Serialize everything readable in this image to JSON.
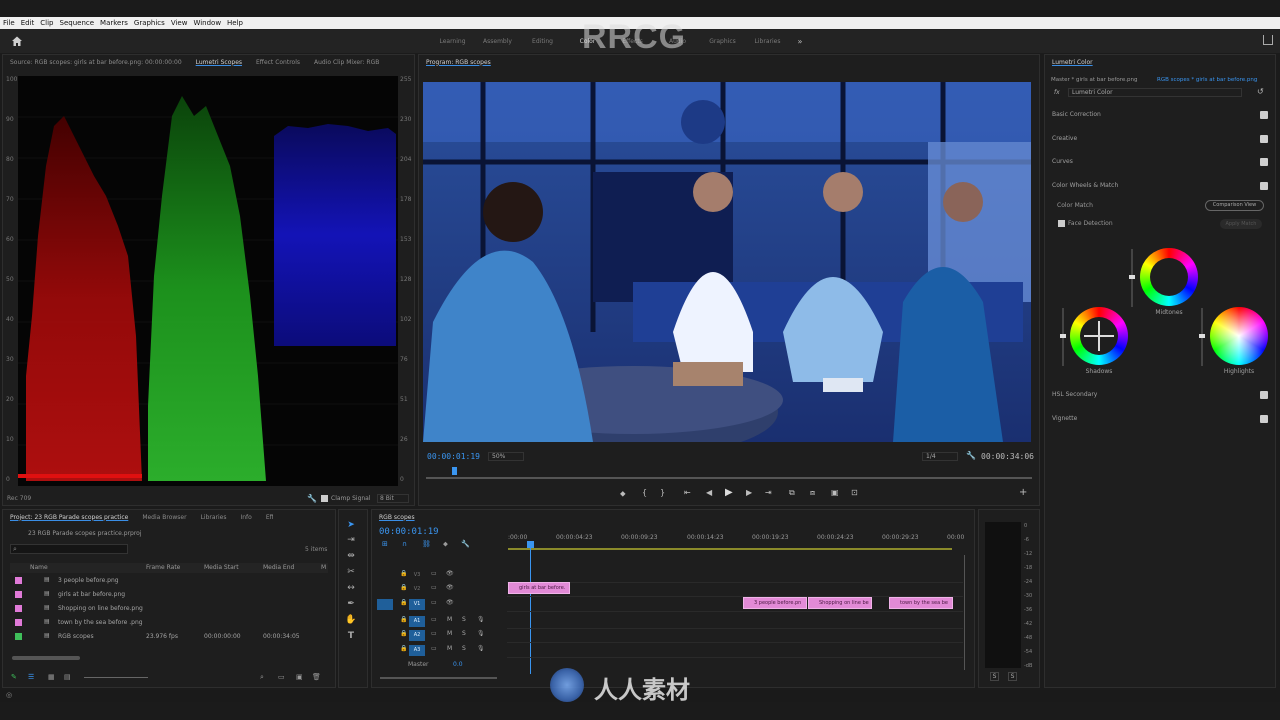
{
  "menu": [
    "File",
    "Edit",
    "Clip",
    "Sequence",
    "Markers",
    "Graphics",
    "View",
    "Window",
    "Help"
  ],
  "workspaces": [
    "Learning",
    "Assembly",
    "Editing",
    "Color",
    "Effects",
    "Audio",
    "Graphics",
    "Libraries"
  ],
  "active_workspace": "Color",
  "watermark": "RRCG",
  "source_panel": {
    "tabs": [
      "Source: RGB scopes: girls at bar before.png: 00:00:00:00",
      "Lumetri Scopes",
      "Effect Controls",
      "Audio Clip Mixer: RGB"
    ],
    "active_tab": "Lumetri Scopes",
    "left_scale": [
      "100",
      "90",
      "80",
      "70",
      "60",
      "50",
      "40",
      "30",
      "20",
      "10",
      "0"
    ],
    "right_scale": [
      "255",
      "230",
      "204",
      "178",
      "153",
      "128",
      "102",
      "76",
      "51",
      "26",
      "0"
    ],
    "footer_left": "Rec 709",
    "clamp_signal": "Clamp Signal",
    "bit_depth": "8 Bit"
  },
  "program": {
    "title": "Program: RGB scopes",
    "timecode": "00:00:01:19",
    "zoom": "50%",
    "resolution": "1/4",
    "duration": "00:00:34:06"
  },
  "lumetri": {
    "title": "Lumetri Color",
    "master": "Master * girls at bar before.png",
    "clip": "RGB scopes * girls at bar before.png",
    "fx": "Lumetri Color",
    "sections": [
      "Basic Correction",
      "Creative",
      "Curves",
      "Color Wheels & Match"
    ],
    "color_match": "Color Match",
    "comparison_view": "Comparison View",
    "face_detection": "Face Detection",
    "apply_match": "Apply Match",
    "wheels": [
      "Midtones",
      "Shadows",
      "Highlights"
    ],
    "lower_sections": [
      "HSL Secondary",
      "Vignette"
    ]
  },
  "project": {
    "tabs": [
      "Project: 23 RGB Parade scopes practice",
      "Media Browser",
      "Libraries",
      "Info",
      "Effects"
    ],
    "active_tab": "Project: 23 RGB Parade scopes practice",
    "file": "23 RGB Parade scopes practice.prproj",
    "count": "5 items",
    "columns": [
      "Name",
      "Frame Rate",
      "Media Start",
      "Media End",
      "M"
    ],
    "items": [
      {
        "name": "3 people before.png",
        "rate": "",
        "start": "",
        "end": "",
        "color": "#e07ad8"
      },
      {
        "name": "girls at bar before.png",
        "rate": "",
        "start": "",
        "end": "",
        "color": "#e07ad8"
      },
      {
        "name": "Shopping on line before.png",
        "rate": "",
        "start": "",
        "end": "",
        "color": "#e07ad8"
      },
      {
        "name": "town by the sea before .png",
        "rate": "",
        "start": "",
        "end": "",
        "color": "#e07ad8"
      },
      {
        "name": "RGB scopes",
        "rate": "23.976 fps",
        "start": "00:00:00:00",
        "end": "00:00:34:05",
        "color": "#3fbf5a"
      }
    ]
  },
  "timeline": {
    "title": "RGB scopes",
    "timecode": "00:00:01:19",
    "ruler": [
      ":00:00",
      "00:00:04:23",
      "00:00:09:23",
      "00:00:14:23",
      "00:00:19:23",
      "00:00:24:23",
      "00:00:29:23",
      "00:00"
    ],
    "tracks": [
      "V3",
      "V2",
      "V1",
      "A1",
      "A2",
      "A3"
    ],
    "master": "Master",
    "master_value": "0.0",
    "clips": [
      {
        "label": "girls at bar before.",
        "track": "V2"
      },
      {
        "label": "3 people before.pn",
        "track": "V1"
      },
      {
        "label": "Shopping on line be",
        "track": "V1"
      },
      {
        "label": "town by the sea be",
        "track": "V1"
      }
    ]
  },
  "audio_meter": {
    "scale": [
      "0",
      "-6",
      "-12",
      "-18",
      "-24",
      "-30",
      "-36",
      "-42",
      "-48",
      "-54",
      "-dB"
    ],
    "solo": [
      "S",
      "S"
    ]
  },
  "bottom_logo": "人人素材"
}
